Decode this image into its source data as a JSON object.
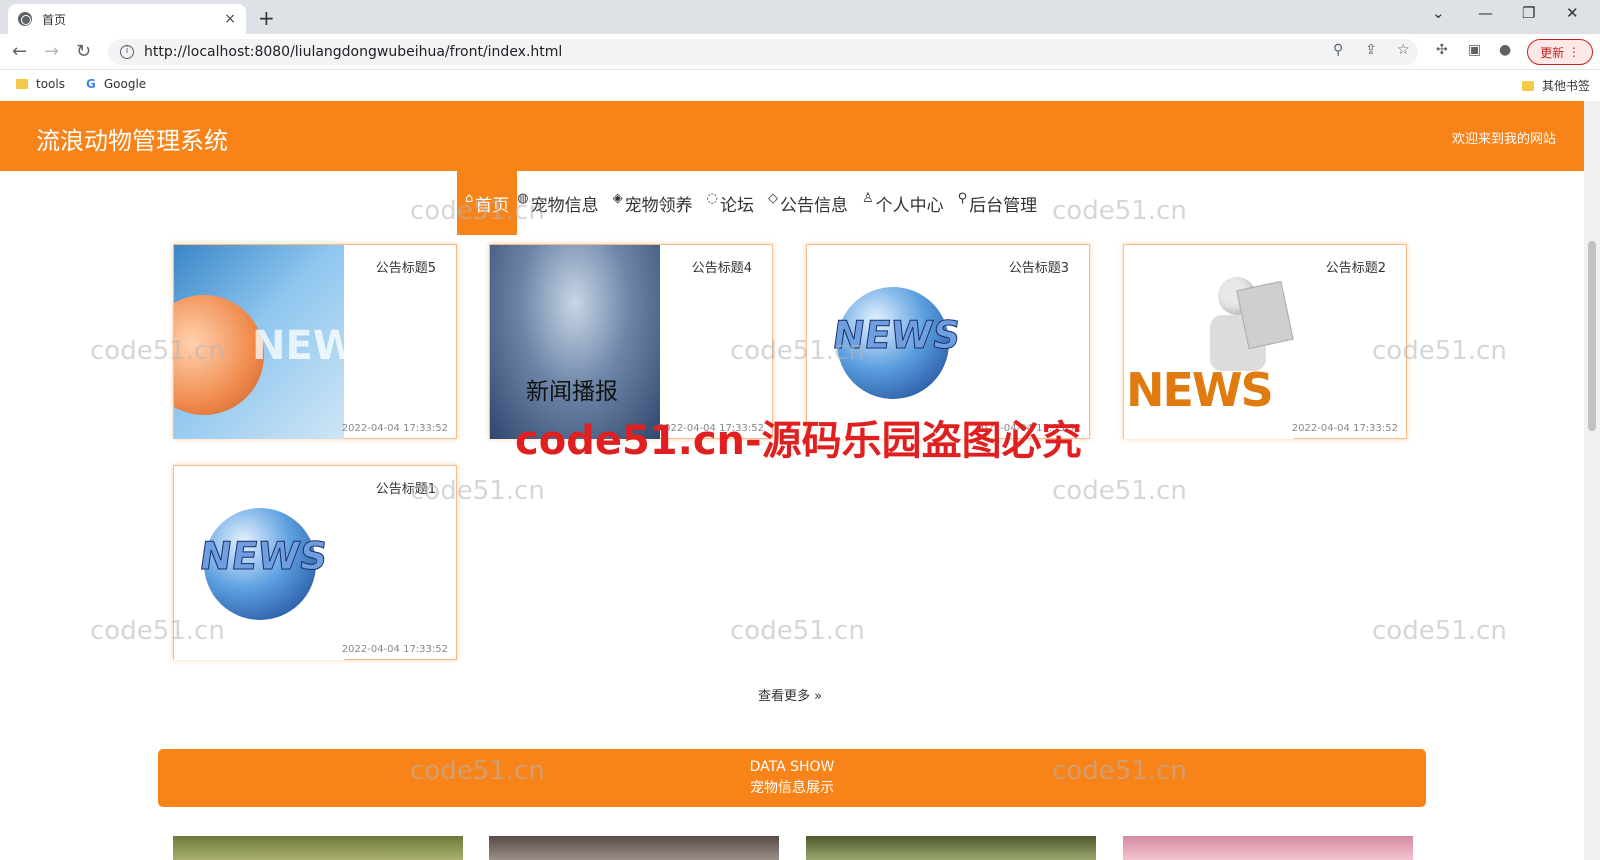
{
  "browser": {
    "tab_title": "首页",
    "tab_close": "×",
    "new_tab": "+",
    "url": "http://localhost:8080/liulangdongwubeihua/front/index.html",
    "update_label": "更新",
    "bookmarks": [
      {
        "label": "tools",
        "icon": "folder-icon"
      },
      {
        "label": "Google",
        "icon": "google-icon"
      }
    ],
    "other_bookmarks": "其他书签"
  },
  "site": {
    "title": "流浪动物管理系统",
    "welcome": "欢迎来到我的网站",
    "accent_color": "#f88319"
  },
  "menu": [
    {
      "label": "首页",
      "icon": "home-icon",
      "glyph": "⌂",
      "active": true
    },
    {
      "label": "宠物信息",
      "icon": "globe-icon",
      "glyph": "◍",
      "active": false
    },
    {
      "label": "宠物领养",
      "icon": "layers-icon",
      "glyph": "◈",
      "active": false
    },
    {
      "label": "论坛",
      "icon": "chat-icon",
      "glyph": "◌",
      "active": false
    },
    {
      "label": "公告信息",
      "icon": "notice-icon",
      "glyph": "◇",
      "active": false
    },
    {
      "label": "个人中心",
      "icon": "user-icon",
      "glyph": "♙",
      "active": false
    },
    {
      "label": "后台管理",
      "icon": "link-icon",
      "glyph": "⚲",
      "active": false
    }
  ],
  "notices": [
    {
      "title": "公告标题5",
      "date": "2022-04-04 17:33:52",
      "image_text": "NEW"
    },
    {
      "title": "公告标题4",
      "date": "2022-04-04 17:33:52",
      "image_text": "新闻播报"
    },
    {
      "title": "公告标题3",
      "date": "2022-04-04 17:33:52",
      "image_text": "NEWS"
    },
    {
      "title": "公告标题2",
      "date": "2022-04-04 17:33:52",
      "image_text": "NEWS"
    },
    {
      "title": "公告标题1",
      "date": "2022-04-04 17:33:52",
      "image_text": "NEWS"
    }
  ],
  "more_label": "查看更多 »",
  "data_show": {
    "en": "DATA SHOW",
    "zh": "宠物信息展示"
  },
  "watermark": "code51.cn",
  "watermark_big": "code51.cn-源码乐园盗图必究"
}
